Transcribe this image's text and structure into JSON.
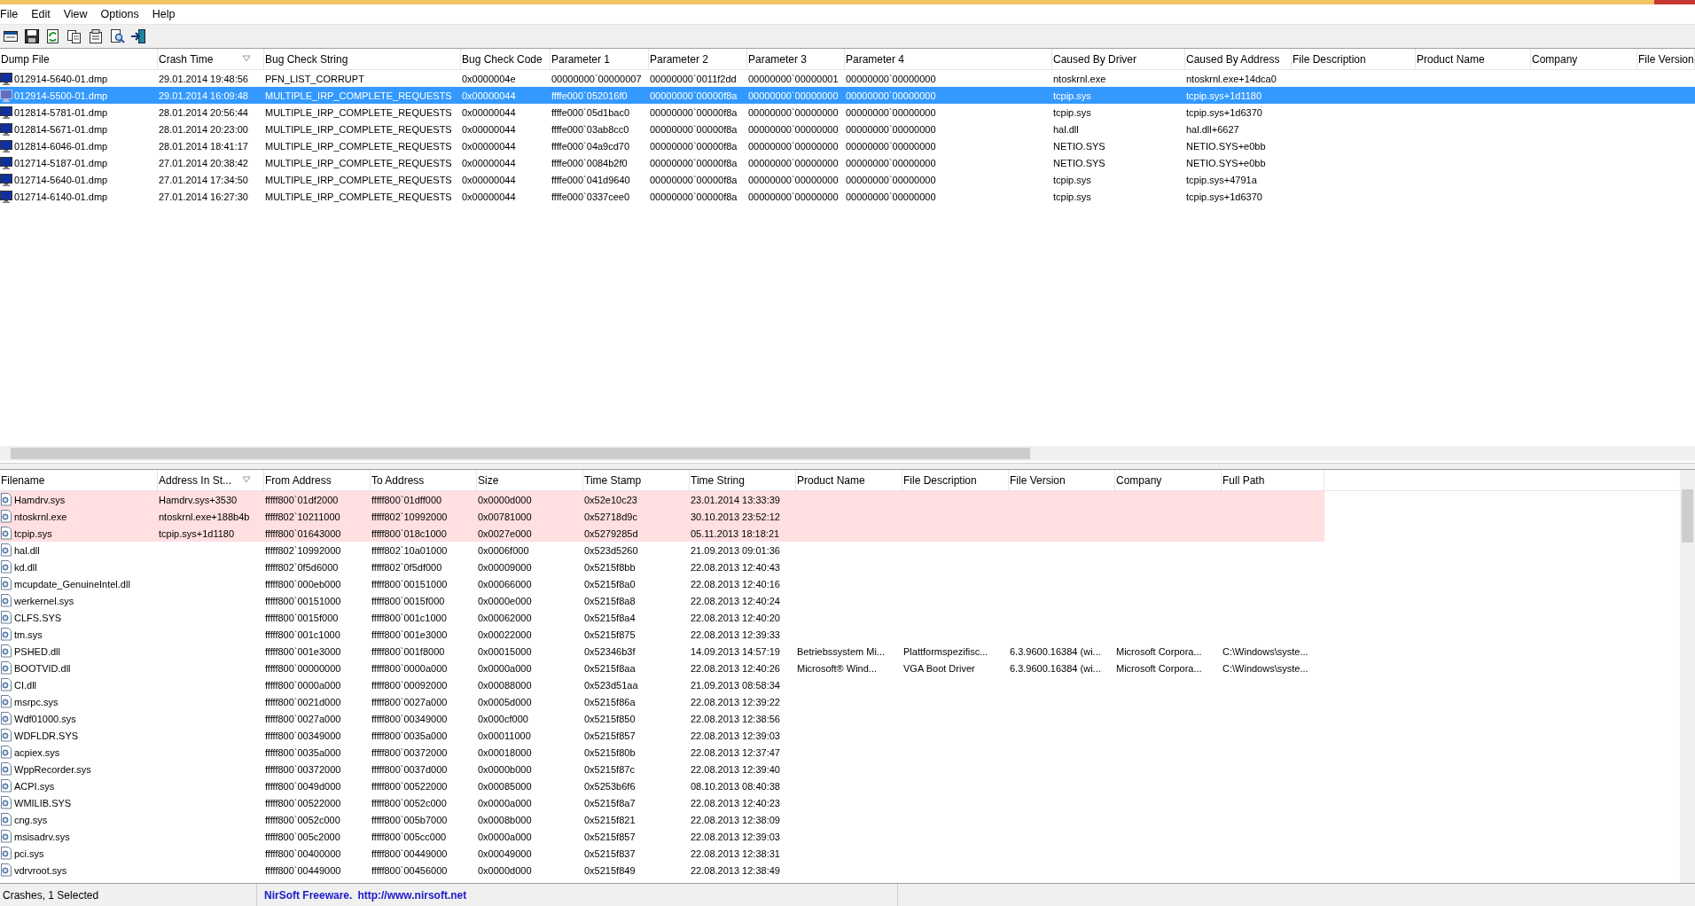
{
  "menu_bar": [
    "File",
    "Edit",
    "View",
    "Options",
    "Help"
  ],
  "toolbar": [
    {
      "kind": "html"
    },
    {
      "kind": "save"
    },
    {
      "kind": "refresh"
    },
    {
      "kind": "copy"
    },
    {
      "kind": "properties"
    },
    {
      "kind": "find"
    },
    {
      "kind": "exit"
    }
  ],
  "crash_table": {
    "columns": [
      {
        "label": "Dump File",
        "sorted": false
      },
      {
        "label": "Crash Time",
        "sorted": true
      },
      {
        "label": "Bug Check String",
        "sorted": false
      },
      {
        "label": "Bug Check Code",
        "sorted": false
      },
      {
        "label": "Parameter 1",
        "sorted": false
      },
      {
        "label": "Parameter 2",
        "sorted": false
      },
      {
        "label": "Parameter 3",
        "sorted": false
      },
      {
        "label": "Parameter 4",
        "sorted": false
      },
      {
        "label": "Caused By Driver",
        "sorted": false
      },
      {
        "label": "Caused By Address",
        "sorted": false
      },
      {
        "label": "File Description",
        "sorted": false
      },
      {
        "label": "Product Name",
        "sorted": false
      },
      {
        "label": "Company",
        "sorted": false
      },
      {
        "label": "File Version",
        "sorted": false
      }
    ],
    "rows": [
      {
        "selected": false,
        "dump_file": "012914-5640-01.dmp",
        "crash_time": "29.01.2014 19:48:56",
        "bug_check_string": "PFN_LIST_CORRUPT",
        "bug_check_code": "0x0000004e",
        "parameter_1": "00000000`00000007",
        "parameter_2": "00000000`0011f2dd",
        "parameter_3": "00000000`00000001",
        "parameter_4": "00000000`00000000",
        "caused_by_driver": "ntoskrnl.exe",
        "caused_by_address": "ntoskrnl.exe+14dca0"
      },
      {
        "selected": true,
        "dump_file": "012914-5500-01.dmp",
        "crash_time": "29.01.2014 16:09:48",
        "bug_check_string": "MULTIPLE_IRP_COMPLETE_REQUESTS",
        "bug_check_code": "0x00000044",
        "parameter_1": "ffffe000`052016f0",
        "parameter_2": "00000000`00000f8a",
        "parameter_3": "00000000`00000000",
        "parameter_4": "00000000`00000000",
        "caused_by_driver": "tcpip.sys",
        "caused_by_address": "tcpip.sys+1d1180"
      },
      {
        "selected": false,
        "dump_file": "012814-5781-01.dmp",
        "crash_time": "28.01.2014 20:56:44",
        "bug_check_string": "MULTIPLE_IRP_COMPLETE_REQUESTS",
        "bug_check_code": "0x00000044",
        "parameter_1": "ffffe000`05d1bac0",
        "parameter_2": "00000000`00000f8a",
        "parameter_3": "00000000`00000000",
        "parameter_4": "00000000`00000000",
        "caused_by_driver": "tcpip.sys",
        "caused_by_address": "tcpip.sys+1d6370"
      },
      {
        "selected": false,
        "dump_file": "012814-5671-01.dmp",
        "crash_time": "28.01.2014 20:23:00",
        "bug_check_string": "MULTIPLE_IRP_COMPLETE_REQUESTS",
        "bug_check_code": "0x00000044",
        "parameter_1": "ffffe000`03ab8cc0",
        "parameter_2": "00000000`00000f8a",
        "parameter_3": "00000000`00000000",
        "parameter_4": "00000000`00000000",
        "caused_by_driver": "hal.dll",
        "caused_by_address": "hal.dll+6627"
      },
      {
        "selected": false,
        "dump_file": "012814-6046-01.dmp",
        "crash_time": "28.01.2014 18:41:17",
        "bug_check_string": "MULTIPLE_IRP_COMPLETE_REQUESTS",
        "bug_check_code": "0x00000044",
        "parameter_1": "ffffe000`04a9cd70",
        "parameter_2": "00000000`00000f8a",
        "parameter_3": "00000000`00000000",
        "parameter_4": "00000000`00000000",
        "caused_by_driver": "NETIO.SYS",
        "caused_by_address": "NETIO.SYS+e0bb"
      },
      {
        "selected": false,
        "dump_file": "012714-5187-01.dmp",
        "crash_time": "27.01.2014 20:38:42",
        "bug_check_string": "MULTIPLE_IRP_COMPLETE_REQUESTS",
        "bug_check_code": "0x00000044",
        "parameter_1": "ffffe000`0084b2f0",
        "parameter_2": "00000000`00000f8a",
        "parameter_3": "00000000`00000000",
        "parameter_4": "00000000`00000000",
        "caused_by_driver": "NETIO.SYS",
        "caused_by_address": "NETIO.SYS+e0bb"
      },
      {
        "selected": false,
        "dump_file": "012714-5640-01.dmp",
        "crash_time": "27.01.2014 17:34:50",
        "bug_check_string": "MULTIPLE_IRP_COMPLETE_REQUESTS",
        "bug_check_code": "0x00000044",
        "parameter_1": "ffffe000`041d9640",
        "parameter_2": "00000000`00000f8a",
        "parameter_3": "00000000`00000000",
        "parameter_4": "00000000`00000000",
        "caused_by_driver": "tcpip.sys",
        "caused_by_address": "tcpip.sys+4791a"
      },
      {
        "selected": false,
        "dump_file": "012714-6140-01.dmp",
        "crash_time": "27.01.2014 16:27:30",
        "bug_check_string": "MULTIPLE_IRP_COMPLETE_REQUESTS",
        "bug_check_code": "0x00000044",
        "parameter_1": "ffffe000`0337cee0",
        "parameter_2": "00000000`00000f8a",
        "parameter_3": "00000000`00000000",
        "parameter_4": "00000000`00000000",
        "caused_by_driver": "tcpip.sys",
        "caused_by_address": "tcpip.sys+1d6370"
      }
    ]
  },
  "driver_table": {
    "columns": [
      {
        "label": "Filename",
        "sorted": false
      },
      {
        "label": "Address In St...",
        "sorted": true
      },
      {
        "label": "From Address",
        "sorted": false
      },
      {
        "label": "To Address",
        "sorted": false
      },
      {
        "label": "Size",
        "sorted": false
      },
      {
        "label": "Time Stamp",
        "sorted": false
      },
      {
        "label": "Time String",
        "sorted": false
      },
      {
        "label": "Product Name",
        "sorted": false
      },
      {
        "label": "File Description",
        "sorted": false
      },
      {
        "label": "File Version",
        "sorted": false
      },
      {
        "label": "Company",
        "sorted": false
      },
      {
        "label": "Full Path",
        "sorted": false
      }
    ],
    "rows": [
      {
        "highlighted": true,
        "filename": "Hamdrv.sys",
        "address_in_stack": "Hamdrv.sys+3530",
        "from_address": "fffff800`01df2000",
        "to_address": "fffff800`01dff000",
        "size": "0x0000d000",
        "time_stamp": "0x52e10c23",
        "time_string": "23.01.2014 13:33:39"
      },
      {
        "highlighted": true,
        "filename": "ntoskrnl.exe",
        "address_in_stack": "ntoskrnl.exe+188b4b",
        "from_address": "fffff802`10211000",
        "to_address": "fffff802`10992000",
        "size": "0x00781000",
        "time_stamp": "0x52718d9c",
        "time_string": "30.10.2013 23:52:12"
      },
      {
        "highlighted": true,
        "filename": "tcpip.sys",
        "address_in_stack": "tcpip.sys+1d1180",
        "from_address": "fffff800`01643000",
        "to_address": "fffff800`018c1000",
        "size": "0x0027e000",
        "time_stamp": "0x5279285d",
        "time_string": "05.11.2013 18:18:21"
      },
      {
        "highlighted": false,
        "filename": "hal.dll",
        "from_address": "fffff802`10992000",
        "to_address": "fffff802`10a01000",
        "size": "0x0006f000",
        "time_stamp": "0x523d5260",
        "time_string": "21.09.2013 09:01:36"
      },
      {
        "highlighted": false,
        "filename": "kd.dll",
        "from_address": "fffff802`0f5d6000",
        "to_address": "fffff802`0f5df000",
        "size": "0x00009000",
        "time_stamp": "0x5215f8bb",
        "time_string": "22.08.2013 12:40:43"
      },
      {
        "highlighted": false,
        "filename": "mcupdate_GenuineIntel.dll",
        "from_address": "fffff800`000eb000",
        "to_address": "fffff800`00151000",
        "size": "0x00066000",
        "time_stamp": "0x5215f8a0",
        "time_string": "22.08.2013 12:40:16"
      },
      {
        "highlighted": false,
        "filename": "werkernel.sys",
        "from_address": "fffff800`00151000",
        "to_address": "fffff800`0015f000",
        "size": "0x0000e000",
        "time_stamp": "0x5215f8a8",
        "time_string": "22.08.2013 12:40:24"
      },
      {
        "highlighted": false,
        "filename": "CLFS.SYS",
        "from_address": "fffff800`0015f000",
        "to_address": "fffff800`001c1000",
        "size": "0x00062000",
        "time_stamp": "0x5215f8a4",
        "time_string": "22.08.2013 12:40:20"
      },
      {
        "highlighted": false,
        "filename": "tm.sys",
        "from_address": "fffff800`001c1000",
        "to_address": "fffff800`001e3000",
        "size": "0x00022000",
        "time_stamp": "0x5215f875",
        "time_string": "22.08.2013 12:39:33"
      },
      {
        "highlighted": false,
        "filename": "PSHED.dll",
        "from_address": "fffff800`001e3000",
        "to_address": "fffff800`001f8000",
        "size": "0x00015000",
        "time_stamp": "0x52346b3f",
        "time_string": "14.09.2013 14:57:19",
        "product_name": "Betriebssystem Mi...",
        "file_description": "Plattformspezifisc...",
        "file_version": "6.3.9600.16384 (wi...",
        "company": "Microsoft Corpora...",
        "full_path": "C:\\Windows\\syste..."
      },
      {
        "highlighted": false,
        "filename": "BOOTVID.dll",
        "from_address": "fffff800`00000000",
        "to_address": "fffff800`0000a000",
        "size": "0x0000a000",
        "time_stamp": "0x5215f8aa",
        "time_string": "22.08.2013 12:40:26",
        "product_name": "Microsoft® Wind...",
        "file_description": "VGA Boot Driver",
        "file_version": "6.3.9600.16384 (wi...",
        "company": "Microsoft Corpora...",
        "full_path": "C:\\Windows\\syste..."
      },
      {
        "highlighted": false,
        "filename": "CI.dll",
        "from_address": "fffff800`0000a000",
        "to_address": "fffff800`00092000",
        "size": "0x00088000",
        "time_stamp": "0x523d51aa",
        "time_string": "21.09.2013 08:58:34"
      },
      {
        "highlighted": false,
        "filename": "msrpc.sys",
        "from_address": "fffff800`0021d000",
        "to_address": "fffff800`0027a000",
        "size": "0x0005d000",
        "time_stamp": "0x5215f86a",
        "time_string": "22.08.2013 12:39:22"
      },
      {
        "highlighted": false,
        "filename": "Wdf01000.sys",
        "from_address": "fffff800`0027a000",
        "to_address": "fffff800`00349000",
        "size": "0x000cf000",
        "time_stamp": "0x5215f850",
        "time_string": "22.08.2013 12:38:56"
      },
      {
        "highlighted": false,
        "filename": "WDFLDR.SYS",
        "from_address": "fffff800`00349000",
        "to_address": "fffff800`0035a000",
        "size": "0x00011000",
        "time_stamp": "0x5215f857",
        "time_string": "22.08.2013 12:39:03"
      },
      {
        "highlighted": false,
        "filename": "acpiex.sys",
        "from_address": "fffff800`0035a000",
        "to_address": "fffff800`00372000",
        "size": "0x00018000",
        "time_stamp": "0x5215f80b",
        "time_string": "22.08.2013 12:37:47"
      },
      {
        "highlighted": false,
        "filename": "WppRecorder.sys",
        "from_address": "fffff800`00372000",
        "to_address": "fffff800`0037d000",
        "size": "0x0000b000",
        "time_stamp": "0x5215f87c",
        "time_string": "22.08.2013 12:39:40"
      },
      {
        "highlighted": false,
        "filename": "ACPI.sys",
        "from_address": "fffff800`0049d000",
        "to_address": "fffff800`00522000",
        "size": "0x00085000",
        "time_stamp": "0x5253b6f6",
        "time_string": "08.10.2013 08:40:38"
      },
      {
        "highlighted": false,
        "filename": "WMILIB.SYS",
        "from_address": "fffff800`00522000",
        "to_address": "fffff800`0052c000",
        "size": "0x0000a000",
        "time_stamp": "0x5215f8a7",
        "time_string": "22.08.2013 12:40:23"
      },
      {
        "highlighted": false,
        "filename": "cng.sys",
        "from_address": "fffff800`0052c000",
        "to_address": "fffff800`005b7000",
        "size": "0x0008b000",
        "time_stamp": "0x5215f821",
        "time_string": "22.08.2013 12:38:09"
      },
      {
        "highlighted": false,
        "filename": "msisadrv.sys",
        "from_address": "fffff800`005c2000",
        "to_address": "fffff800`005cc000",
        "size": "0x0000a000",
        "time_stamp": "0x5215f857",
        "time_string": "22.08.2013 12:39:03"
      },
      {
        "highlighted": false,
        "filename": "pci.sys",
        "from_address": "fffff800`00400000",
        "to_address": "fffff800`00449000",
        "size": "0x00049000",
        "time_stamp": "0x5215f837",
        "time_string": "22.08.2013 12:38:31"
      },
      {
        "highlighted": false,
        "filename": "vdrvroot.sys",
        "from_address": "fffff800`00449000",
        "to_address": "fffff800`00456000",
        "size": "0x0000d000",
        "time_stamp": "0x5215f849",
        "time_string": "22.08.2013 12:38:49"
      }
    ]
  },
  "status_bar": {
    "count": "Crashes, 1 Selected",
    "credit": "NirSoft Freeware.",
    "link": "http://www.nirsoft.net"
  }
}
